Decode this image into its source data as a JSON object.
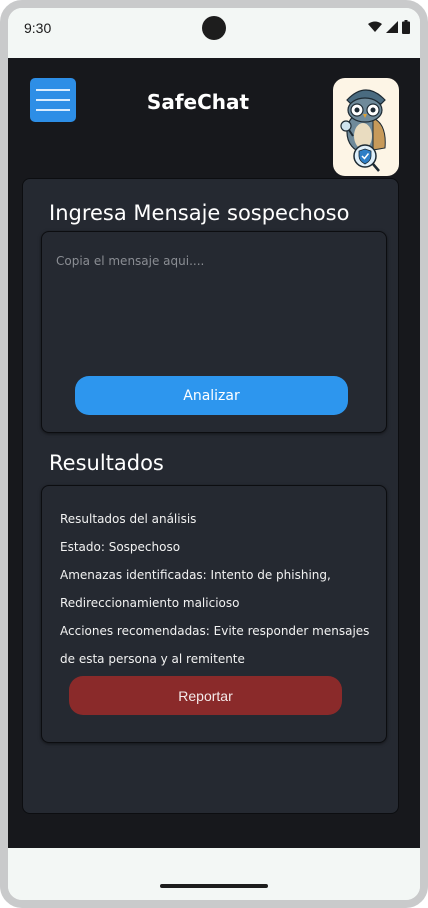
{
  "status_bar": {
    "time": "9:30",
    "icons": [
      "wifi-icon",
      "cellular-signal-icon",
      "battery-icon"
    ]
  },
  "header": {
    "menu_icon": "hamburger-menu-icon",
    "title": "SafeChat",
    "avatar_icon": "owl-detective-icon"
  },
  "input_section": {
    "title": "Ingresa Mensaje sospechoso",
    "placeholder": "Copia el mensaje aqui....",
    "value": "",
    "analyze_label": "Analizar"
  },
  "results_section": {
    "title": "Resultados",
    "lines": [
      "Resultados del análisis",
      "Estado: Sospechoso",
      "Amenazas identificadas: Intento de phishing,",
      "Redireccionamiento malicioso",
      "Acciones recomendadas: Evite responder mensajes",
      "de esta persona y al remitente"
    ],
    "report_label": "Reportar"
  },
  "colors": {
    "background": "#17181c",
    "card": "#252931",
    "accent_blue": "#2d96ee",
    "report_red": "#8a2a2a"
  }
}
